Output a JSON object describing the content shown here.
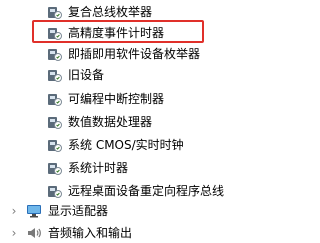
{
  "device_tree": {
    "system_devices": [
      {
        "label": "复合总线枚举器"
      },
      {
        "label": "高精度事件计时器"
      },
      {
        "label": "即插即用软件设备枚举器"
      },
      {
        "label": "旧设备"
      },
      {
        "label": "可编程中断控制器"
      },
      {
        "label": "数值数据处理器"
      },
      {
        "label": "系统 CMOS/实时时钟"
      },
      {
        "label": "系统计时器"
      },
      {
        "label": "远程桌面设备重定向程序总线"
      }
    ],
    "categories": [
      {
        "label": "显示适配器",
        "icon": "display-adapter-icon",
        "expand_glyph": "›"
      },
      {
        "label": "音频输入和输出",
        "icon": "audio-icon",
        "expand_glyph": "›"
      }
    ]
  },
  "highlighted_item": "高精度事件计时器",
  "colors": {
    "highlight_border": "#e0302a",
    "chevron": "#7a7a7a"
  }
}
